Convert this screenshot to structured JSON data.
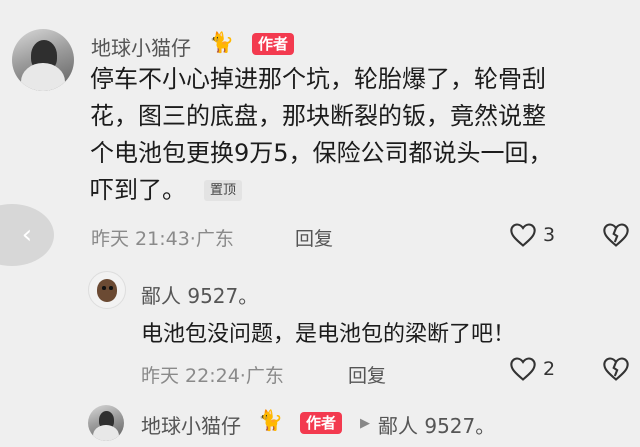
{
  "comment": {
    "username": "地球小猫仔",
    "author_badge": "作者",
    "lines": [
      "停车不小心掉进那个坑，轮胎爆了，轮骨刮",
      "花，图三的底盘，那块断裂的钣，竟然说整",
      "个电池包更换9万5，保险公司都说头一回，",
      "吓到了。"
    ],
    "pin_badge": "置顶",
    "time": "昨天 21:43",
    "location": "广东",
    "reply_label": "回复",
    "likes": "3",
    "icons": {
      "like": "heart-icon",
      "dislike": "broken-heart-icon",
      "back": "chevron-left-icon",
      "cat": "cat-icon"
    }
  },
  "reply1": {
    "username": "鄙人 9527。",
    "text": "电池包没问题，是电池包的梁断了吧！",
    "time": "昨天 22:24",
    "location": "广东",
    "reply_label": "回复",
    "likes": "2"
  },
  "reply2": {
    "username": "地球小猫仔",
    "author_badge": "作者",
    "reply_to": "鄙人 9527。"
  }
}
